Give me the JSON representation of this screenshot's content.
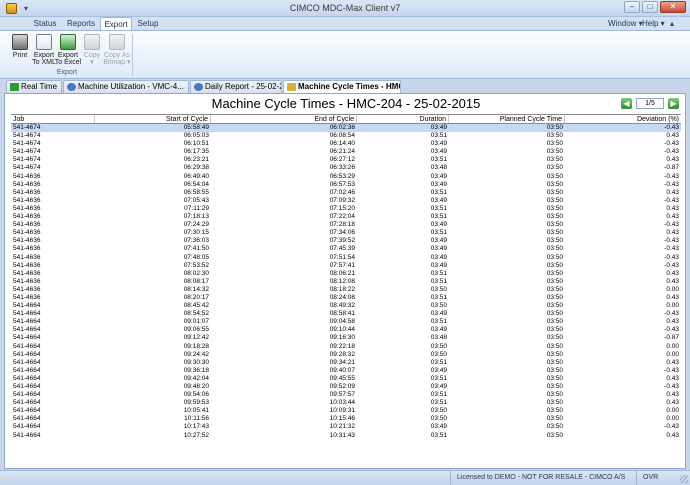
{
  "window": {
    "title": "CIMCO MDC-Max Client v7"
  },
  "icons": {
    "app": "app-logo-icon",
    "qat": "quick-access-dropdown-icon"
  },
  "ribbon_tabs": [
    "Status",
    "Reports",
    "Export",
    "Setup"
  ],
  "ribbon_right": {
    "window": "Window ▾",
    "help": "Help ▾"
  },
  "ribbon_group": {
    "label": "Export",
    "buttons": [
      {
        "label1": "Print",
        "label2": "",
        "icon": "print-icon",
        "enabled": true
      },
      {
        "label1": "Export",
        "label2": "To XML",
        "icon": "xml-export-icon",
        "enabled": true
      },
      {
        "label1": "Export",
        "label2": "To Excel",
        "icon": "excel-export-icon",
        "enabled": true
      },
      {
        "label1": "Copy",
        "label2": "▾",
        "icon": "copy-icon",
        "enabled": false
      },
      {
        "label1": "Copy As",
        "label2": "Bitmap ▾",
        "icon": "bitmap-icon",
        "enabled": false
      }
    ]
  },
  "doc_tabs": [
    {
      "label": "Real Time",
      "icon_color": "#2f9a2f"
    },
    {
      "label": "Machine Utilization - VMC-4...",
      "icon_color": "#4a77c4"
    },
    {
      "label": "Daily Report - 25-02-2015",
      "icon_color": "#4a77c4"
    },
    {
      "label": "Machine Cycle Times - HMC...",
      "icon_color": "#d9b13a",
      "active": true
    }
  ],
  "report": {
    "title": "Machine Cycle Times  -  HMC-204  -  25-02-2015",
    "page": "1/5"
  },
  "table": {
    "columns": [
      "Job",
      "Start of Cycle",
      "End of Cycle",
      "Duration",
      "Planned Cycle Time",
      "Deviation (%)"
    ],
    "rows": [
      [
        "541-4674",
        "05:58:49",
        "06:02:38",
        "03:49",
        "03:50",
        "-0.43"
      ],
      [
        "541-4674",
        "06:05:03",
        "06:08:54",
        "03:51",
        "03:50",
        "0.43"
      ],
      [
        "541-4674",
        "06:10:51",
        "06:14:40",
        "03:49",
        "03:50",
        "-0.43"
      ],
      [
        "541-4674",
        "06:17:35",
        "06:21:24",
        "03:49",
        "03:50",
        "-0.43"
      ],
      [
        "541-4674",
        "06:23:21",
        "06:27:12",
        "03:51",
        "03:50",
        "0.43"
      ],
      [
        "541-4674",
        "06:29:38",
        "06:33:26",
        "03:48",
        "03:50",
        "-0.87"
      ],
      [
        "541-4636",
        "06:49:40",
        "06:53:29",
        "03:49",
        "03:50",
        "-0.43"
      ],
      [
        "541-4636",
        "06:54:04",
        "06:57:53",
        "03:49",
        "03:50",
        "-0.43"
      ],
      [
        "541-4636",
        "06:58:55",
        "07:02:46",
        "03:51",
        "03:50",
        "0.43"
      ],
      [
        "541-4636",
        "07:05:43",
        "07:09:32",
        "03:49",
        "03:50",
        "-0.43"
      ],
      [
        "541-4636",
        "07:11:29",
        "07:15:20",
        "03:51",
        "03:50",
        "0.43"
      ],
      [
        "541-4636",
        "07:18:13",
        "07:22:04",
        "03:51",
        "03:50",
        "0.43"
      ],
      [
        "541-4636",
        "07:24:29",
        "07:28:18",
        "03:49",
        "03:50",
        "-0.43"
      ],
      [
        "541-4636",
        "07:30:15",
        "07:34:06",
        "03:51",
        "03:50",
        "0.43"
      ],
      [
        "541-4636",
        "07:36:03",
        "07:39:52",
        "03:49",
        "03:50",
        "-0.43"
      ],
      [
        "541-4636",
        "07:41:50",
        "07:45:39",
        "03:49",
        "03:50",
        "-0.43"
      ],
      [
        "541-4636",
        "07:48:05",
        "07:51:54",
        "03:49",
        "03:50",
        "-0.43"
      ],
      [
        "541-4636",
        "07:53:52",
        "07:57:41",
        "03:49",
        "03:50",
        "-0.43"
      ],
      [
        "541-4636",
        "08:02:30",
        "08:06:21",
        "03:51",
        "03:50",
        "0.43"
      ],
      [
        "541-4636",
        "08:08:17",
        "08:12:08",
        "03:51",
        "03:50",
        "0.43"
      ],
      [
        "541-4636",
        "08:14:32",
        "08:18:22",
        "03:50",
        "03:50",
        "0.00"
      ],
      [
        "541-4636",
        "08:20:17",
        "08:24:08",
        "03:51",
        "03:50",
        "0.43"
      ],
      [
        "541-4664",
        "08:45:42",
        "08:49:32",
        "03:50",
        "03:50",
        "0.00"
      ],
      [
        "541-4664",
        "08:54:52",
        "08:58:41",
        "03:49",
        "03:50",
        "-0.43"
      ],
      [
        "541-4664",
        "09:01:07",
        "09:04:58",
        "03:51",
        "03:50",
        "0.43"
      ],
      [
        "541-4664",
        "09:06:55",
        "09:10:44",
        "03:49",
        "03:50",
        "-0.43"
      ],
      [
        "541-4664",
        "09:12:42",
        "09:16:30",
        "03:48",
        "03:50",
        "-0.87"
      ],
      [
        "541-4664",
        "09:18:28",
        "09:22:18",
        "03:50",
        "03:50",
        "0.00"
      ],
      [
        "541-4664",
        "09:24:42",
        "09:28:32",
        "03:50",
        "03:50",
        "0.00"
      ],
      [
        "541-4664",
        "09:30:30",
        "09:34:21",
        "03:51",
        "03:50",
        "0.43"
      ],
      [
        "541-4664",
        "09:36:18",
        "09:40:07",
        "03:49",
        "03:50",
        "-0.43"
      ],
      [
        "541-4664",
        "09:42:04",
        "09:45:55",
        "03:51",
        "03:50",
        "0.43"
      ],
      [
        "541-4664",
        "09:48:20",
        "09:52:09",
        "03:49",
        "03:50",
        "-0.43"
      ],
      [
        "541-4664",
        "09:54:06",
        "09:57:57",
        "03:51",
        "03:50",
        "0.43"
      ],
      [
        "541-4664",
        "09:59:53",
        "10:03:44",
        "03:51",
        "03:50",
        "0.43"
      ],
      [
        "541-4664",
        "10:05:41",
        "10:09:31",
        "03:50",
        "03:50",
        "0.00"
      ],
      [
        "541-4664",
        "10:11:56",
        "10:15:46",
        "03:50",
        "03:50",
        "0.00"
      ],
      [
        "541-4664",
        "10:17:43",
        "10:21:32",
        "03:49",
        "03:50",
        "-0.43"
      ],
      [
        "541-4664",
        "10:27:52",
        "10:31:43",
        "03:51",
        "03:50",
        "0.43"
      ]
    ]
  },
  "status": {
    "license": "Licensed to DEMO - NOT FOR RESALE - CIMCO A/S",
    "mode": "OVR"
  },
  "colors": {
    "accent": "#c5d9f4",
    "ribbon": "#d3e0f1"
  }
}
